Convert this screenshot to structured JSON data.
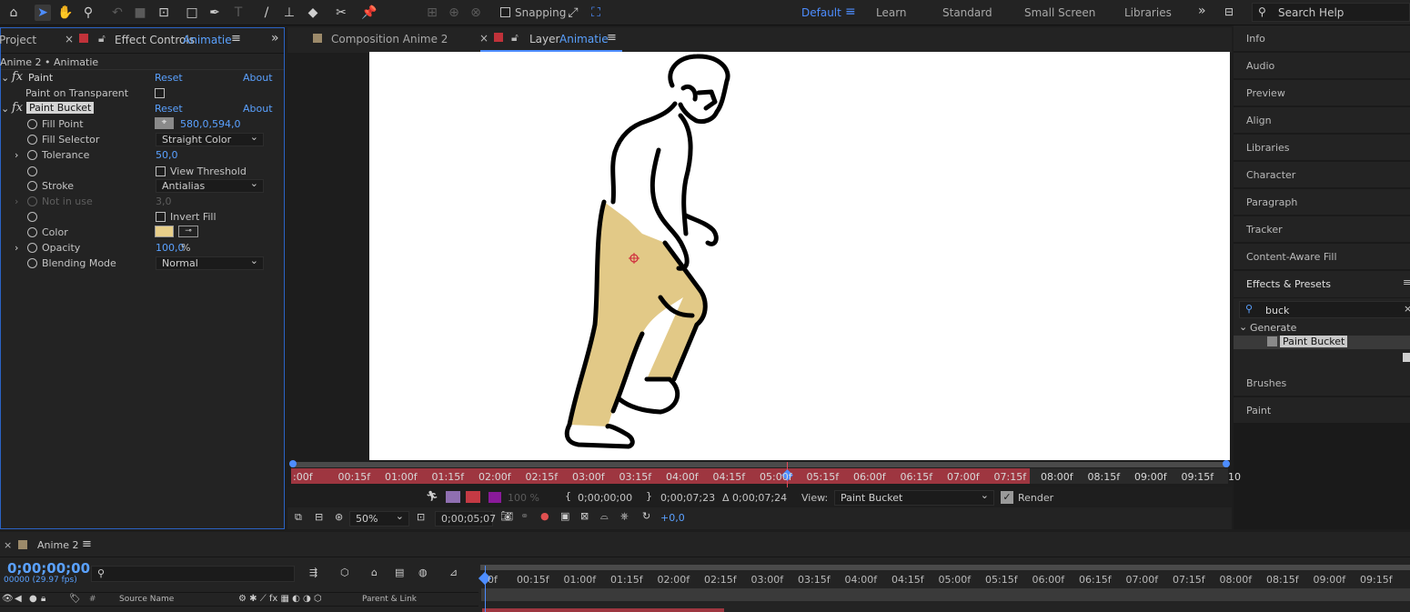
{
  "toolbar": {
    "snapping_label": "Snapping",
    "workspaces": [
      "Default",
      "Learn",
      "Standard",
      "Small Screen",
      "Libraries"
    ],
    "search_placeholder": "Search Help",
    "icons": [
      "home-icon",
      "selection-arrow-icon",
      "hand-icon",
      "zoom-icon",
      "rotate-icon",
      "camera-icon",
      "pan-behind-icon",
      "rectangle-icon",
      "pen-icon",
      "text-icon",
      "brush-icon",
      "clone-stamp-icon",
      "eraser-icon",
      "roto-brush-icon",
      "puppet-pin-icon"
    ]
  },
  "left_panel": {
    "tab_project": "Project",
    "tab_effect_controls": "Effect Controls",
    "tab_effect_controls_layer": "Animatie",
    "breadcrumb": "Anime 2 • Animatie",
    "effects": [
      {
        "name": "Paint",
        "reset": "Reset",
        "about": "About"
      },
      {
        "name": "Paint Bucket",
        "reset": "Reset",
        "about": "About"
      }
    ],
    "paint_on_transparent": "Paint on Transparent",
    "props": {
      "fill_point_label": "Fill Point",
      "fill_point_value": "580,0,594,0",
      "fill_selector_label": "Fill Selector",
      "fill_selector_value": "Straight Color",
      "tolerance_label": "Tolerance",
      "tolerance_value": "50,0",
      "view_threshold_label": "View Threshold",
      "stroke_label": "Stroke",
      "stroke_value": "Antialias",
      "not_in_use_label": "Not in use",
      "not_in_use_value": "3,0",
      "invert_fill_label": "Invert Fill",
      "color_label": "Color",
      "color_value": "#e8cf8a",
      "opacity_label": "Opacity",
      "opacity_value": "100,0",
      "opacity_unit": "%",
      "blending_label": "Blending Mode",
      "blending_value": "Normal"
    }
  },
  "viewer": {
    "tab_composition": "Composition Anime 2",
    "tab_layer": "Layer",
    "tab_layer_name": "Animatie",
    "ruler_labels": [
      ":00f",
      "00:15f",
      "01:00f",
      "01:15f",
      "02:00f",
      "02:15f",
      "03:00f",
      "03:15f",
      "04:00f",
      "04:15f",
      "05:00f",
      "05:15f",
      "06:00f",
      "06:15f",
      "07:00f",
      "07:15f",
      "08:00f",
      "08:15f",
      "09:00f",
      "09:15f",
      "10"
    ],
    "controls": {
      "opacity_pct": "100 %",
      "in_time": "0;00;00;00",
      "out_time": "0;00;07;23",
      "duration": "Δ 0;00;07;24",
      "view_label": "View:",
      "view_value": "Paint Bucket",
      "render_label": "Render"
    },
    "footer": {
      "zoom": "50%",
      "timecode": "0;00;05;07",
      "exposure": "+0,0"
    }
  },
  "right_panel": {
    "items": [
      "Info",
      "Audio",
      "Preview",
      "Align",
      "Libraries",
      "Character",
      "Paragraph",
      "Tracker",
      "Content-Aware Fill"
    ],
    "effects_presets_title": "Effects & Presets",
    "search_value": "buck",
    "category": "Generate",
    "result": "Paint Bucket",
    "items_after": [
      "Brushes",
      "Paint"
    ]
  },
  "timeline": {
    "tab": "Anime 2",
    "timecode": "0;00;00;00",
    "fps_text": "00000 (29.97 fps)",
    "search_placeholder": "",
    "col_source": "Source Name",
    "col_parent": "Parent & Link",
    "col_hash": "#",
    "ruler_labels": [
      "0f",
      "00:15f",
      "01:00f",
      "01:15f",
      "02:00f",
      "02:15f",
      "03:00f",
      "03:15f",
      "04:00f",
      "04:15f",
      "05:00f",
      "05:15f",
      "06:00f",
      "06:15f",
      "07:00f",
      "07:15f",
      "08:00f",
      "08:15f",
      "09:00f",
      "09:15f"
    ]
  }
}
